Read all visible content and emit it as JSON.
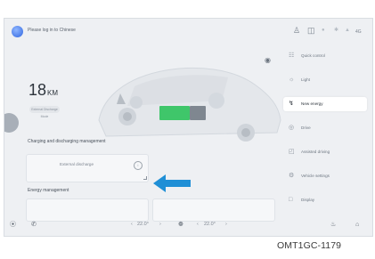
{
  "header": {
    "title": "Please log in to Chinese",
    "icons": [
      "person-icon",
      "car-icon",
      "wifi-icon",
      "bluetooth-icon",
      "signal-icon"
    ],
    "right_label": "4G"
  },
  "range": {
    "value": "18",
    "unit": "KM",
    "subtitle": "External Discharge Mode"
  },
  "sections": {
    "charging": "Charging and discharging management",
    "energy": "Energy management"
  },
  "discharge_button": {
    "label": "External discharge"
  },
  "menu": [
    {
      "label": "Quick control",
      "icon": "sliders-icon"
    },
    {
      "label": "Light",
      "icon": "light-icon"
    },
    {
      "label": "New energy",
      "icon": "new-energy-icon",
      "active": true
    },
    {
      "label": "Drive",
      "icon": "steering-icon"
    },
    {
      "label": "Assisted driving",
      "icon": "assist-drive-icon"
    },
    {
      "label": "Vehicle settings",
      "icon": "vehicle-settings-icon"
    },
    {
      "label": "Display",
      "icon": "display-icon"
    }
  ],
  "bottom": {
    "left_temp": "22.0°",
    "right_temp": "22.0°"
  },
  "caption": "OMT1GC-1179",
  "colors": {
    "accent_arrow": "#1f8fd6",
    "battery_green": "#3fc66a",
    "background": "#eef0f3"
  }
}
